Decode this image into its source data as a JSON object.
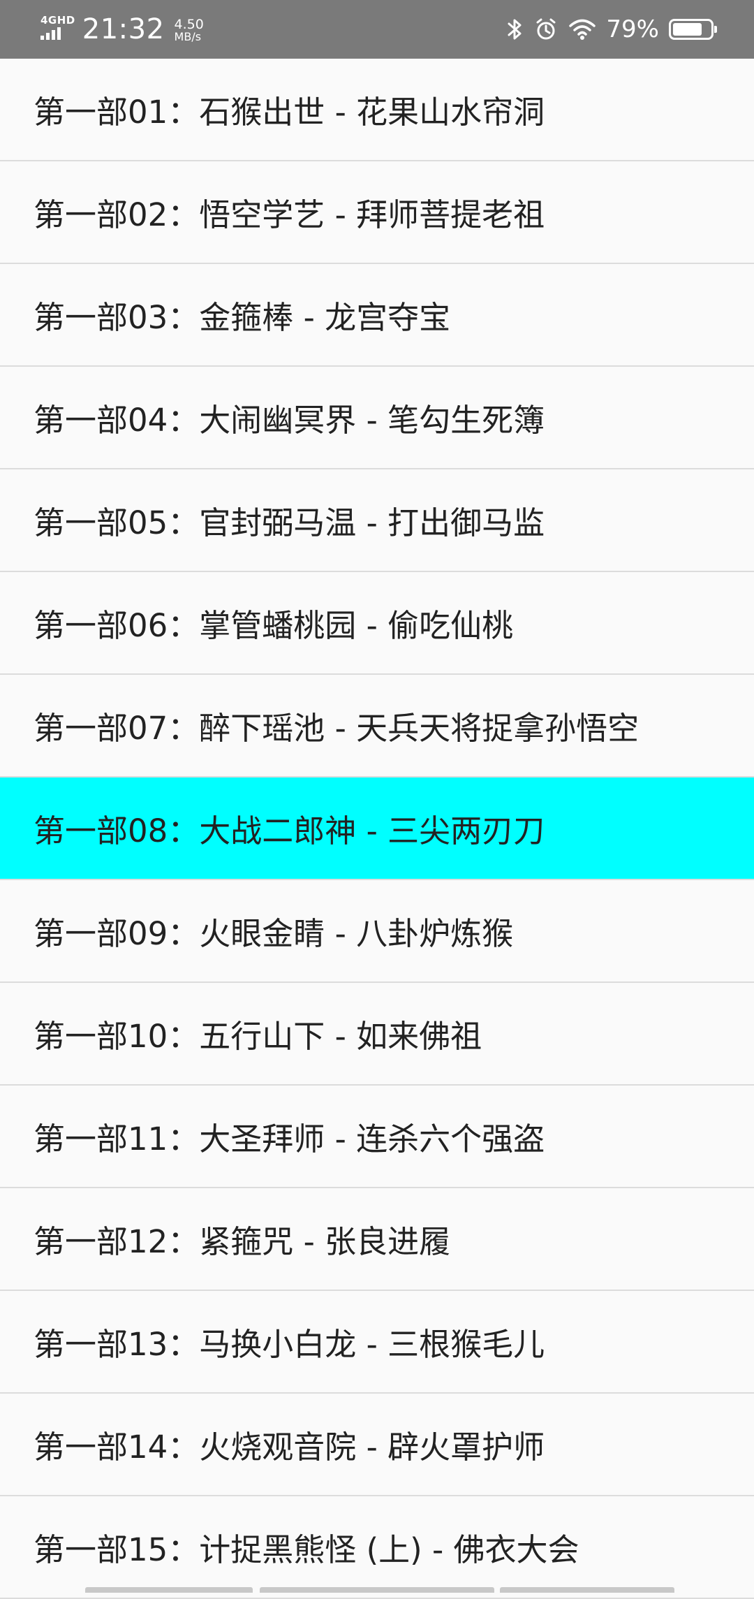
{
  "status_bar": {
    "network_type": "4GHD",
    "time": "21:32",
    "speed_value": "4.50",
    "speed_unit": "MB/s",
    "icons": [
      "bluetooth-icon",
      "alarm-icon",
      "wifi-icon"
    ],
    "battery_percent": "79%",
    "battery_level": 0.79,
    "background_color": "#7a7a7a"
  },
  "episodes": {
    "selected_index": 7,
    "selected_color": "#00ffff",
    "items": [
      {
        "label": "第一部01：石猴出世 - 花果山水帘洞"
      },
      {
        "label": "第一部02：悟空学艺 - 拜师菩提老祖"
      },
      {
        "label": "第一部03：金箍棒 - 龙宫夺宝"
      },
      {
        "label": "第一部04：大闹幽冥界 - 笔勾生死簿"
      },
      {
        "label": "第一部05：官封弼马温 - 打出御马监"
      },
      {
        "label": "第一部06：掌管蟠桃园 - 偷吃仙桃"
      },
      {
        "label": "第一部07：醉下瑶池 - 天兵天将捉拿孙悟空"
      },
      {
        "label": "第一部08：大战二郎神 - 三尖两刃刀"
      },
      {
        "label": "第一部09：火眼金睛 - 八卦炉炼猴"
      },
      {
        "label": "第一部10：五行山下 - 如来佛祖"
      },
      {
        "label": "第一部11：大圣拜师 - 连杀六个强盗"
      },
      {
        "label": "第一部12：紧箍咒 - 张良进履"
      },
      {
        "label": "第一部13：马换小白龙 - 三根猴毛儿"
      },
      {
        "label": "第一部14：火烧观音院 - 辟火罩护师"
      },
      {
        "label": "第一部15：计捉黑熊怪 (上) - 佛衣大会"
      }
    ]
  }
}
